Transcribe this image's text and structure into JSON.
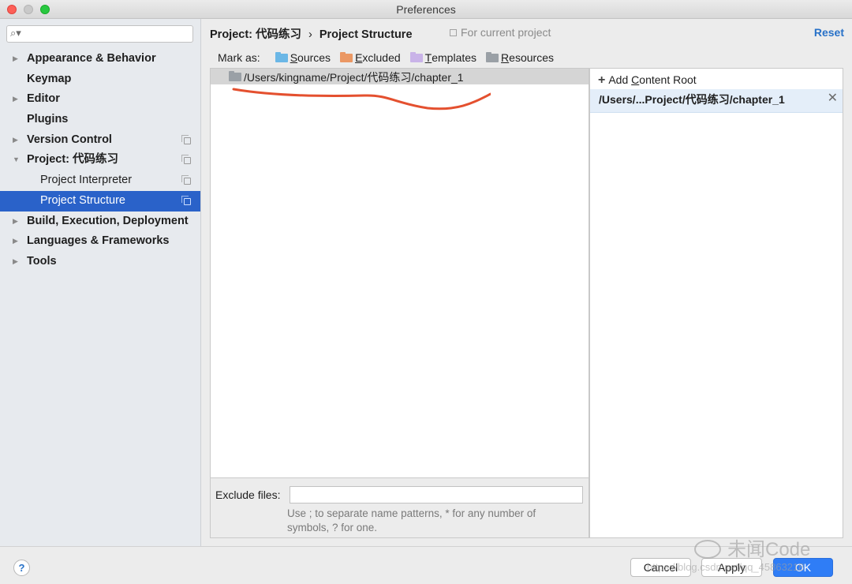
{
  "window": {
    "title": "Preferences"
  },
  "sidebar": {
    "search_placeholder": "",
    "items": [
      {
        "label": "Appearance & Behavior",
        "expandable": true,
        "expanded": false,
        "child": false,
        "copy_icon": false,
        "selected": false
      },
      {
        "label": "Keymap",
        "expandable": false,
        "child": false,
        "copy_icon": false,
        "selected": false
      },
      {
        "label": "Editor",
        "expandable": true,
        "expanded": false,
        "child": false,
        "copy_icon": false,
        "selected": false
      },
      {
        "label": "Plugins",
        "expandable": false,
        "child": false,
        "copy_icon": false,
        "selected": false
      },
      {
        "label": "Version Control",
        "expandable": true,
        "expanded": false,
        "child": false,
        "copy_icon": true,
        "selected": false
      },
      {
        "label": "Project: 代码练习",
        "expandable": true,
        "expanded": true,
        "child": false,
        "copy_icon": true,
        "selected": false
      },
      {
        "label": "Project Interpreter",
        "expandable": false,
        "child": true,
        "copy_icon": true,
        "selected": false
      },
      {
        "label": "Project Structure",
        "expandable": false,
        "child": true,
        "copy_icon": true,
        "selected": true
      },
      {
        "label": "Build, Execution, Deployment",
        "expandable": true,
        "expanded": false,
        "child": false,
        "copy_icon": false,
        "selected": false
      },
      {
        "label": "Languages & Frameworks",
        "expandable": true,
        "expanded": false,
        "child": false,
        "copy_icon": false,
        "selected": false
      },
      {
        "label": "Tools",
        "expandable": true,
        "expanded": false,
        "child": false,
        "copy_icon": false,
        "selected": false
      }
    ]
  },
  "header": {
    "breadcrumb_parent": "Project: 代码练习",
    "breadcrumb_sep": "›",
    "breadcrumb_current": "Project Structure",
    "for_current_project": "For current project",
    "reset_label": "Reset"
  },
  "mark_as": {
    "label": "Mark as:",
    "buttons": [
      {
        "first": "S",
        "rest": "ources",
        "color": "#6bb7e6"
      },
      {
        "first": "E",
        "rest": "xcluded",
        "color": "#eb9864"
      },
      {
        "first": "T",
        "rest": "emplates",
        "color": "#c9b3e8"
      },
      {
        "first": "R",
        "rest": "esources",
        "color": "#9aa0a6"
      }
    ]
  },
  "tree": {
    "root_path": "/Users/kingname/Project/代码练习/chapter_1",
    "annotation_color": "#e4502f"
  },
  "content_roots": {
    "add_plus": "+",
    "add_prefix": "Add ",
    "add_u": "C",
    "add_rest": "ontent Root",
    "root_path": "/Users/...Project/代码练习/chapter_1",
    "remove_glyph": "✕"
  },
  "exclude": {
    "label": "Exclude files:",
    "value": "",
    "help_line1": "Use ; to separate name patterns, * for any number of",
    "help_line2": "symbols, ? for one."
  },
  "footer": {
    "help_glyph": "?",
    "cancel_label": "Cancel",
    "apply_label": "Apply",
    "ok_label": "OK"
  },
  "watermark": {
    "brand": "未闻Code",
    "url": "https://blog.csdn.net/qq_45863218"
  }
}
